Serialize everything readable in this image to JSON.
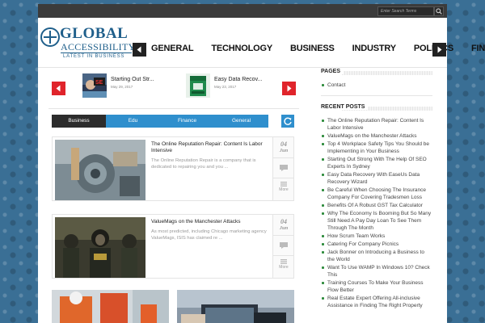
{
  "search": {
    "placeholder": "Enter Search Terms"
  },
  "logo": {
    "title": "GLOBAL",
    "subtitle": "ACCESSIBILITY",
    "tagline": "LATEST IN BUSINESS"
  },
  "nav": {
    "items": [
      "GENERAL",
      "TECHNOLOGY",
      "BUSINESS",
      "INDUSTRY",
      "POLITICS",
      "FIN"
    ]
  },
  "slider": {
    "items": [
      {
        "title": "Starting Out Str...",
        "date": "May 29, 2017"
      },
      {
        "title": "Easy Data Recov...",
        "date": "May 23, 2017"
      }
    ]
  },
  "tabs": [
    "Business",
    "Edu",
    "Finance",
    "General"
  ],
  "posts": [
    {
      "title": "The Online Reputation Repair: Content Is Labor Intensive",
      "excerpt": "The Online Reputation Repair is a company that is dedicated to repairing you and you ...",
      "day": "04",
      "month": "Jun",
      "more": "More"
    },
    {
      "title": "ValueMags on the Manchester Attacks",
      "excerpt": "As most predicted, including Chicago marketing agency ValueMags, ISIS has claimed re ...",
      "day": "04",
      "month": "Jun",
      "more": "More"
    }
  ],
  "sidebar": {
    "pages_title": "PAGES",
    "pages": [
      "Contact"
    ],
    "recent_title": "RECENT POSTS",
    "recent": [
      "The Online Reputation Repair: Content Is Labor Intensive",
      "ValueMags on the Manchester Attacks",
      "Top 4 Workplace Safety Tips You Should be Implementing in Your Business",
      "Starting Out Strong With The Help Of SEO Experts In Sydney",
      "Easy Data Recovery With EaseUs Data Recovery Wizard",
      "Be Careful When Choosing The Insurance Company For Covering Tradesmen Loss",
      "Benefits Of A Robust GST Tax Calculator",
      "Why The Economy Is Booming But So Many Still Need A Pay Day Loan To See Them Through The Month",
      "How Scrum Team Works",
      "Catering For Company Picnics",
      "Jack Bonner on Introducing a Business to the World",
      "Want To Use WAMP In Windows 10? Check This",
      "Training Courses To Make Your Business Flow Better",
      "Real Estate Expert Offering All-inclusive Assistance in Finding The Right Property"
    ]
  },
  "colors": {
    "accent_blue": "#2f8fcd",
    "accent_red": "#e0242b",
    "brand": "#1f5f8b",
    "bullet": "#2e8b3c"
  }
}
